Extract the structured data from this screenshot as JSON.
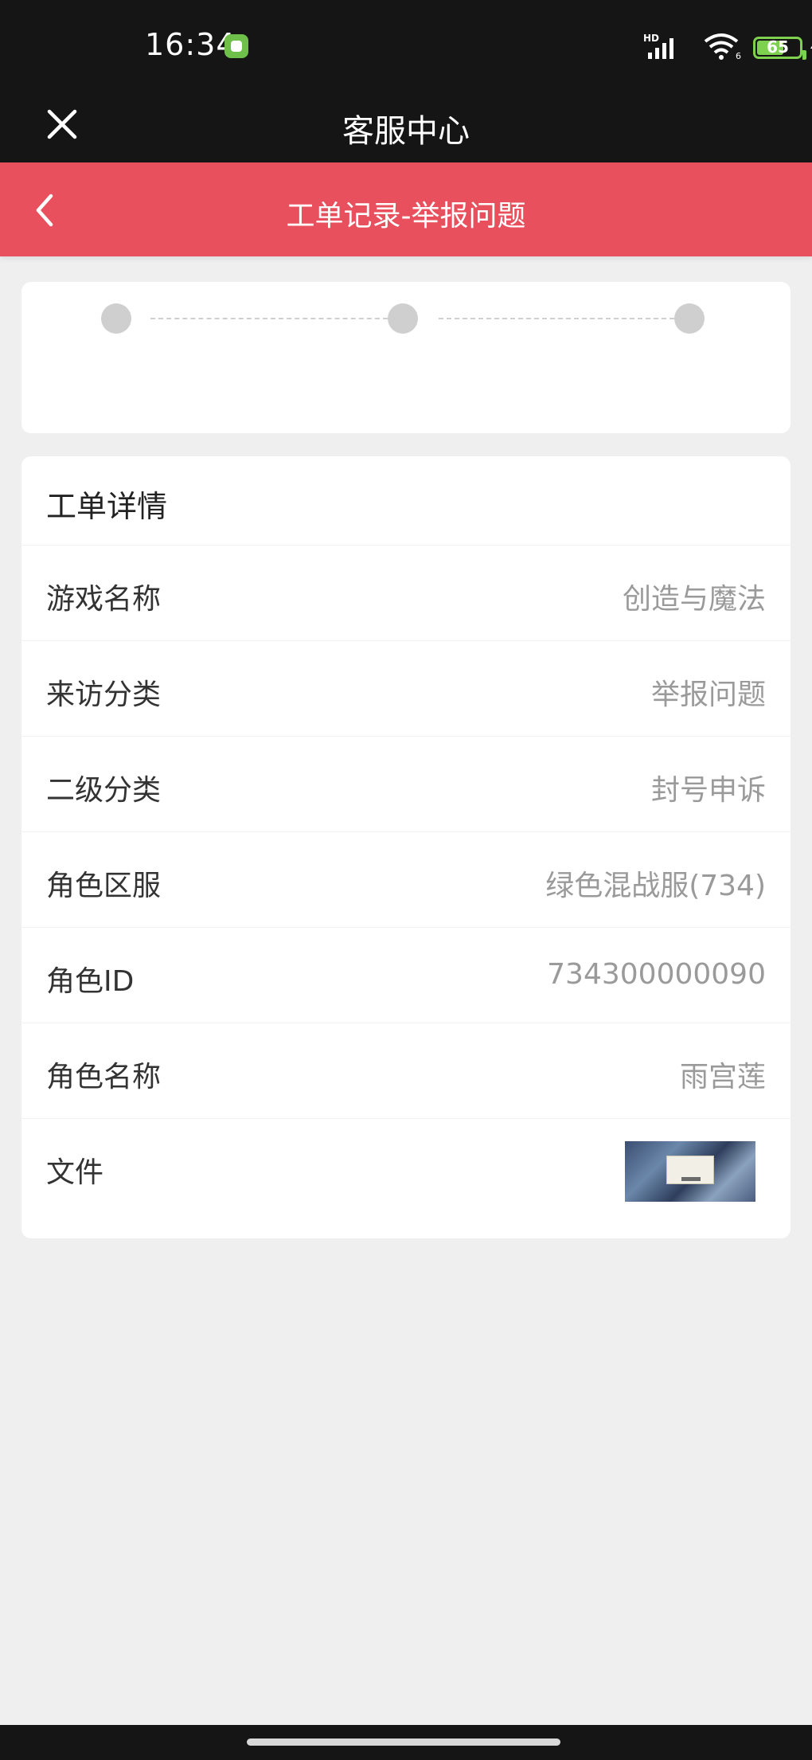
{
  "status_bar": {
    "time": "16:34",
    "battery_level": "65",
    "battery_fraction": 0.65,
    "network": "HD"
  },
  "app_header": {
    "title": "客服中心",
    "close_icon": "close-icon"
  },
  "nav": {
    "title": "工单记录-举报问题",
    "back_icon": "chevron-left-icon"
  },
  "progress": {
    "step_count": 3
  },
  "detail": {
    "title": "工单详情",
    "rows": [
      {
        "label": "游戏名称",
        "value": "创造与魔法"
      },
      {
        "label": "来访分类",
        "value": "举报问题"
      },
      {
        "label": "二级分类",
        "value": "封号申诉"
      },
      {
        "label": "角色区服",
        "value": "绿色混战服(734)"
      },
      {
        "label": "角色ID",
        "value": "734300000090"
      },
      {
        "label": "角色名称",
        "value": "雨宫莲"
      }
    ],
    "file_label": "文件"
  },
  "colors": {
    "accent": "#e8505d",
    "header_bg": "#151515",
    "page_bg": "#efefef",
    "value_text": "#9a9a9a"
  }
}
